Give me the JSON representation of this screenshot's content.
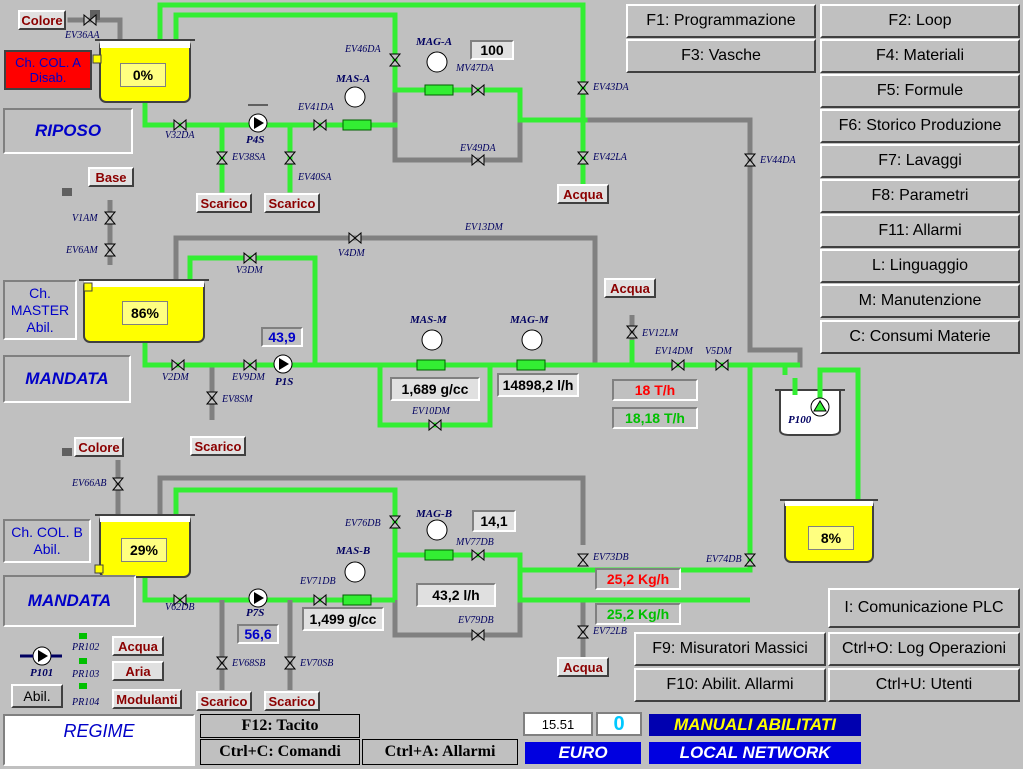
{
  "fkeys": {
    "f1": "F1: Programmazione",
    "f2": "F2: Loop",
    "f3": "F3: Vasche",
    "f4": "F4: Materiali",
    "f5": "F5: Formule",
    "f6": "F6: Storico Produzione",
    "f7": "F7: Lavaggi",
    "f8": "F8: Parametri",
    "f11": "F11: Allarmi",
    "l": "L: Linguaggio",
    "m": "M: Manutenzione",
    "c": "C: Consumi Materie",
    "i": "I: Comunicazione PLC",
    "f9": "F9: Misuratori Massici",
    "ctrl_o": "Ctrl+O: Log Operazioni",
    "f10": "F10: Abilit. Allarmi",
    "ctrl_u": "Ctrl+U: Utenti"
  },
  "line_a": {
    "color_tag": "Colore",
    "status": "Ch. COL. A\nDisab.",
    "mode": "RIPOSO",
    "level": "0%",
    "valves": [
      "EV36AA",
      "EV46DA",
      "EV41DA",
      "EV38SA",
      "EV40SA",
      "V32DA",
      "EV49DA",
      "MV47DA",
      "EV43DA",
      "EV42LA",
      "EV44DA"
    ],
    "pump": "P4S",
    "mag": "MAG-A",
    "mas": "MAS-A",
    "mag_value": "100",
    "scarico1": "Scarico",
    "scarico2": "Scarico",
    "acqua": "Acqua"
  },
  "line_master": {
    "base_tag": "Base",
    "status": "Ch.\nMASTER\nAbil.",
    "mode": "MANDATA",
    "level": "86%",
    "valves": [
      "V1AM",
      "EV6AM",
      "V3DM",
      "V4DM",
      "EV13DM",
      "V2DM",
      "EV9DM",
      "EV8SM",
      "EV10DM",
      "EV12LM",
      "EV14DM",
      "V5DM"
    ],
    "pump": "P1S",
    "pump_value": "43,9",
    "mas": "MAS-M",
    "mag": "MAG-M",
    "density": "1,689 g/cc",
    "flow": "14898,2 l/h",
    "acqua": "Acqua",
    "set_rate": "18 T/h",
    "actual_rate": "18,18 T/h",
    "scarico": "Scarico"
  },
  "line_b": {
    "color_tag": "Colore",
    "status": "Ch. COL. B\nAbil.",
    "mode": "MANDATA",
    "level": "29%",
    "valves": [
      "EV66AB",
      "EV76DB",
      "V62DB",
      "EV71DB",
      "EV68SB",
      "EV70SB",
      "MV77DB",
      "EV79DB",
      "EV73DB",
      "EV72LB",
      "EV74DB"
    ],
    "pump": "P7S",
    "pump_value": "56,6",
    "mag": "MAG-B",
    "mas": "MAS-B",
    "mag_value": "14,1",
    "density": "1,499 g/cc",
    "flow": "43,2 l/h",
    "set_rate": "25,2 Kg/h",
    "actual_rate": "25,2 Kg/h",
    "scarico1": "Scarico",
    "scarico2": "Scarico",
    "acqua": "Acqua"
  },
  "mixer": {
    "pump": "P100",
    "level": "8%"
  },
  "utilities": {
    "pump": "P101",
    "pr": [
      "PR102",
      "PR103",
      "PR104"
    ],
    "tags": [
      "Acqua",
      "Aria",
      "Modulanti"
    ],
    "abil": "Abil."
  },
  "bottom": {
    "regime": "REGIME",
    "f12": "F12: Tacito",
    "ctrl_c": "Ctrl+C: Comandi",
    "ctrl_a": "Ctrl+A: Allarmi",
    "time": "15.51",
    "counter": "0",
    "manuali": "MANUALI ABILITATI",
    "currency": "EURO",
    "network": "LOCAL NETWORK"
  },
  "colors": {
    "pipe_active": "#33ee33",
    "pipe_idle": "#808080",
    "tank_fill": "#ffff00",
    "alarm_red": "#ff0000",
    "ok_green": "#00c000",
    "nav_blue": "#0000e0"
  }
}
